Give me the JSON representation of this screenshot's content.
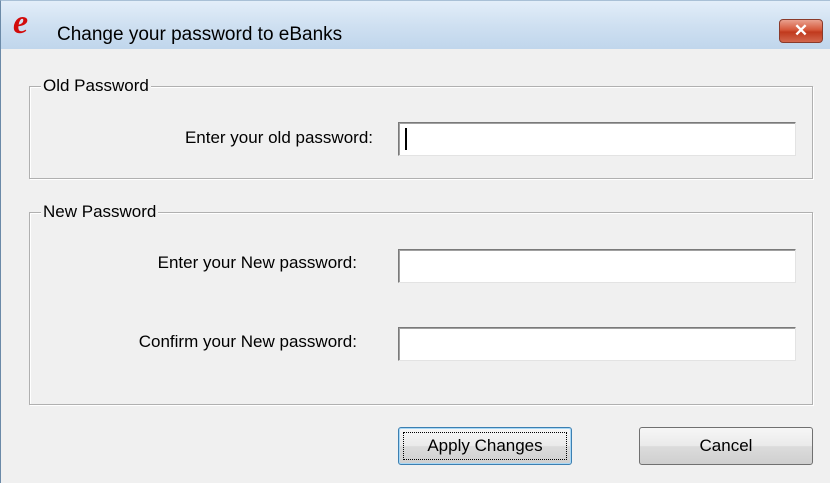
{
  "window": {
    "title": "Change your password to eBanks",
    "logo_glyph": "e",
    "logo_color": "#d20b0b",
    "close_glyph": "✕",
    "close_color": "#c0391d"
  },
  "old_password": {
    "group_label": "Old Password",
    "field_label": "Enter your old password:",
    "value": ""
  },
  "new_password": {
    "group_label": "New Password",
    "new_label": "Enter your New password:",
    "new_value": "",
    "confirm_label": "Confirm your New password:",
    "confirm_value": ""
  },
  "buttons": {
    "apply": "Apply Changes",
    "cancel": "Cancel"
  }
}
